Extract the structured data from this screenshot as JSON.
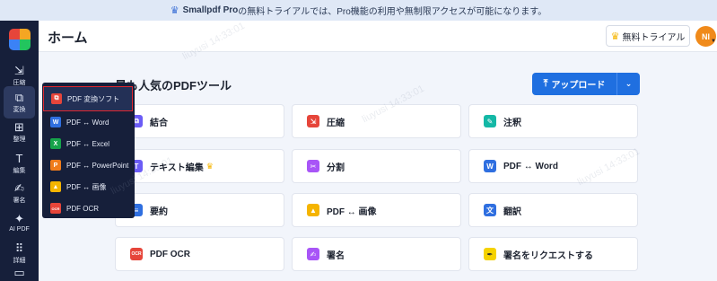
{
  "banner": {
    "brand": "Smallpdf Pro",
    "text": "の無料トライアルでは、Pro機能の利用や無制限アクセスが可能になります。"
  },
  "header": {
    "title": "ホーム",
    "trial_label": "無料トライアル",
    "avatar_initials": "NI"
  },
  "sidebar": {
    "items": [
      {
        "label": "圧縮",
        "icon": "compress-icon"
      },
      {
        "label": "変換",
        "icon": "convert-icon"
      },
      {
        "label": "整理",
        "icon": "organize-icon"
      },
      {
        "label": "編集",
        "icon": "edit-icon"
      },
      {
        "label": "署名",
        "icon": "sign-icon"
      },
      {
        "label": "AI PDF",
        "icon": "ai-icon"
      },
      {
        "label": "詳細",
        "icon": "more-icon"
      }
    ]
  },
  "main": {
    "section_title": "最も人気のPDFツール",
    "upload_label": "アップロード",
    "tools": [
      {
        "label": "結合",
        "color": "#6b5cf6"
      },
      {
        "label": "圧縮",
        "color": "#e6453a"
      },
      {
        "label": "注釈",
        "color": "#14b8a6"
      },
      {
        "label": "テキスト編集",
        "color": "#6b5cf6"
      },
      {
        "label": "分割",
        "color": "#a855f7"
      },
      {
        "label": "PDF ↔ Word",
        "color": "#2f6fe0"
      },
      {
        "label": "要約",
        "color": "#2f6fe0"
      },
      {
        "label": "PDF ↔ 画像",
        "color": "#f5b400"
      },
      {
        "label": "翻訳",
        "color": "#2f6fe0"
      },
      {
        "label": "PDF OCR",
        "color": "#e6453a"
      },
      {
        "label": "署名",
        "color": "#a855f7"
      },
      {
        "label": "署名をリクエストする",
        "color": "#f5d200"
      }
    ]
  },
  "dropdown": {
    "items": [
      {
        "label": "PDF 変換ソフト",
        "color": "#e6453a"
      },
      {
        "label": "PDF ↔ Word",
        "color": "#2f6fe0"
      },
      {
        "label": "PDF ↔ Excel",
        "color": "#16a34a"
      },
      {
        "label": "PDF ↔ PowerPoint",
        "color": "#f07c1a"
      },
      {
        "label": "PDF ↔ 画像",
        "color": "#f5b400"
      },
      {
        "label": "PDF OCR",
        "color": "#e6453a"
      }
    ]
  },
  "watermark": "liuyusi 14:33:01"
}
